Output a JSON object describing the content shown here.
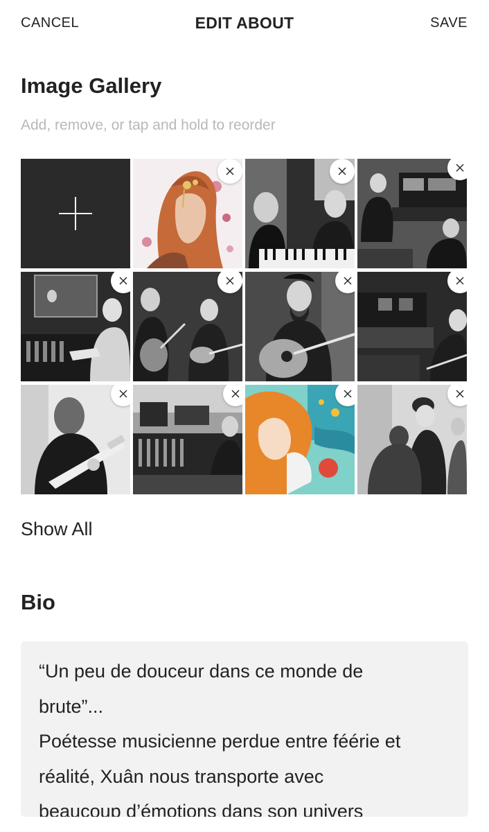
{
  "header": {
    "cancel_label": "CANCEL",
    "title": "EDIT ABOUT",
    "save_label": "SAVE"
  },
  "gallery": {
    "heading": "Image Gallery",
    "hint": "Add, remove, or tap and hold to reorder",
    "add_icon": "plus-icon",
    "remove_icon": "close-icon",
    "photos": [
      {
        "style": "color-portrait-red-hair"
      },
      {
        "style": "bw-keyboard-duo"
      },
      {
        "style": "bw-studio-group"
      },
      {
        "style": "bw-vocal-booth"
      },
      {
        "style": "bw-guitar-bass-duo"
      },
      {
        "style": "bw-acoustic-guitarist"
      },
      {
        "style": "bw-studio-guitarist"
      },
      {
        "style": "bw-electric-guitarist"
      },
      {
        "style": "bw-mixing-desk"
      },
      {
        "style": "color-illustration"
      },
      {
        "style": "bw-duo-portrait"
      }
    ],
    "show_all_label": "Show All"
  },
  "bio": {
    "heading": "Bio",
    "lines": [
      "“Un peu de douceur dans ce monde de",
      "brute”...",
      "Poétesse musicienne perdue entre féérie et",
      "réalité, Xuân nous transporte avec",
      "beaucoup d’émotions dans son univers"
    ]
  },
  "colors": {
    "add_tile": "#2a2a2a",
    "hint_text": "#b8b8b8",
    "bio_background": "#f2f2f2"
  }
}
